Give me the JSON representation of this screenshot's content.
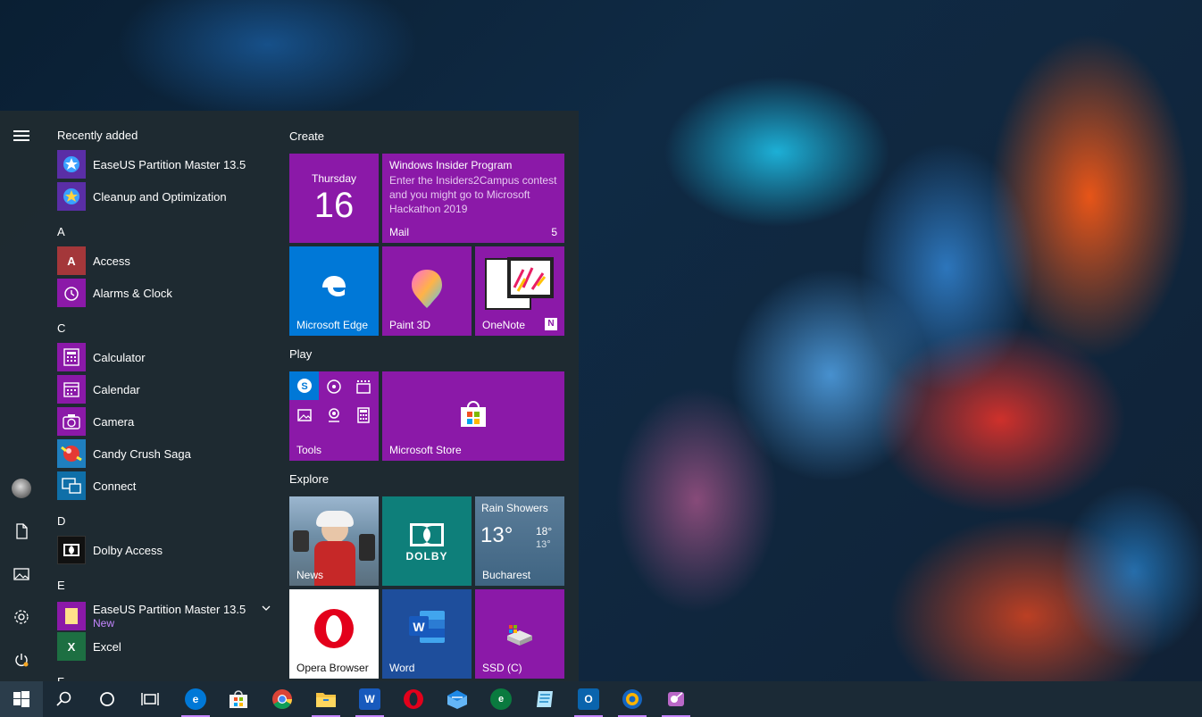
{
  "start_menu": {
    "recently_added_label": "Recently added",
    "recent_apps": [
      {
        "label": "EaseUS Partition Master 13.5",
        "icon": "easeus-icon",
        "color": "#5a2ea6"
      },
      {
        "label": "Cleanup and Optimization",
        "icon": "cleanup-icon",
        "color": "#5a2ea6"
      }
    ],
    "sections": [
      {
        "letter": "A",
        "apps": [
          {
            "label": "Access",
            "icon": "access-icon",
            "color": "#a4373a",
            "glyph": "A"
          },
          {
            "label": "Alarms & Clock",
            "icon": "alarm-clock-icon",
            "color": "#8b19a8",
            "glyph": "⏰"
          }
        ]
      },
      {
        "letter": "C",
        "apps": [
          {
            "label": "Calculator",
            "icon": "calculator-icon",
            "color": "#8b19a8",
            "glyph": "▦"
          },
          {
            "label": "Calendar",
            "icon": "calendar-icon",
            "color": "#8b19a8",
            "glyph": "▤"
          },
          {
            "label": "Camera",
            "icon": "camera-icon",
            "color": "#8b19a8",
            "glyph": "◉"
          },
          {
            "label": "Candy Crush Saga",
            "icon": "candy-crush-icon",
            "color": "#1f7fbf",
            "glyph": "●"
          },
          {
            "label": "Connect",
            "icon": "connect-icon",
            "color": "#0f6fa8",
            "glyph": "⧉"
          }
        ]
      },
      {
        "letter": "D",
        "apps": [
          {
            "label": "Dolby Access",
            "icon": "dolby-icon",
            "color": "#111111",
            "glyph": "◧"
          }
        ]
      },
      {
        "letter": "E",
        "apps": [
          {
            "label": "EaseUS Partition Master 13.5",
            "sub": "New",
            "icon": "folder-icon",
            "color": "#8b19a8",
            "glyph": "▭",
            "expandable": true
          },
          {
            "label": "Excel",
            "icon": "excel-icon",
            "color": "#1d6f42",
            "glyph": "X"
          }
        ]
      }
    ],
    "next_letter": "F"
  },
  "tiles": {
    "groups": {
      "create": "Create",
      "play": "Play",
      "explore": "Explore"
    },
    "calendar": {
      "day": "Thursday",
      "date": "16"
    },
    "mail": {
      "title": "Windows Insider Program",
      "body": "Enter the Insiders2Campus contest and you might go to Microsoft Hackathon 2019",
      "label": "Mail",
      "count": "5"
    },
    "edge": {
      "label": "Microsoft Edge"
    },
    "paint3d": {
      "label": "Paint 3D"
    },
    "onenote": {
      "label": "OneNote"
    },
    "tools": {
      "label": "Tools"
    },
    "store": {
      "label": "Microsoft Store"
    },
    "news": {
      "label": "News"
    },
    "dolby": {
      "label": "DOLBY"
    },
    "weather": {
      "condition": "Rain Showers",
      "temp": "13°",
      "high": "18°",
      "low": "13°",
      "city": "Bucharest"
    },
    "opera": {
      "label": "Opera Browser"
    },
    "word": {
      "label": "Word"
    },
    "ssd": {
      "label": "SSD (C)"
    }
  },
  "colors": {
    "accent": "#8b19a8",
    "edge_blue": "#0078d7",
    "taskbar": "#1b2a36"
  }
}
